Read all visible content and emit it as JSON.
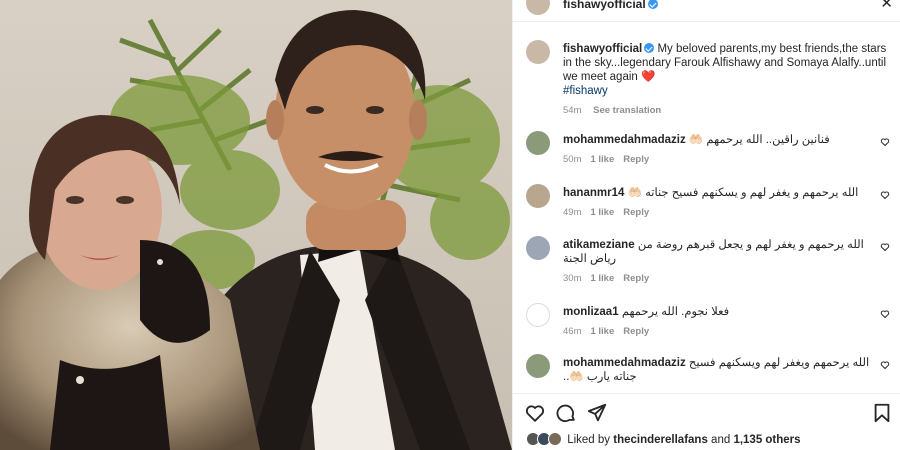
{
  "post": {
    "username": "fishawyofficial",
    "close_glyph": "✕",
    "image_alt": "Vintage photo of a couple, a woman in a fur coat and a man in a tuxedo with a bow tie"
  },
  "caption": {
    "username": "fishawyofficial",
    "text": "My beloved parents,my best friends,the stars in the sky...legendary Farouk Alfishawy and Somaya Alalfy..until we meet again",
    "emoji": "❤️",
    "hashtag": "#fishawy",
    "time": "54m",
    "see_translation": "See translation"
  },
  "comments": [
    {
      "username": "mohammedahmadaziz",
      "text": "فنانين راقين.. الله يرحمهم 🤲🏻",
      "time": "50m",
      "likes": "1 like",
      "reply": "Reply",
      "avatar_color": "#8a9a7a"
    },
    {
      "username": "hananmr14",
      "text": "الله يرحمهم و يغفر لهم و يسكنهم فسيح جناته 🤲🏻",
      "time": "49m",
      "likes": "1 like",
      "reply": "Reply",
      "avatar_color": "#b9a68f"
    },
    {
      "username": "atikameziane",
      "text": "الله يرحمهم و يغفر لهم و يجعل قبرهم روضة من رياض الجنة",
      "time": "30m",
      "likes": "1 like",
      "reply": "Reply",
      "avatar_color": "#9ca6b5"
    },
    {
      "username": "monlizaa1",
      "text": "فعلا نجوم. الله يرحمهم",
      "time": "46m",
      "likes": "1 like",
      "reply": "Reply",
      "avatar_color": "#ffffff"
    },
    {
      "username": "mohammedahmadaziz",
      "text": "الله يرحمهم ويغفر لهم ويسكنهم فسيح جناته يارب 🤲🏻..",
      "time": "",
      "likes": "",
      "reply": "",
      "avatar_color": "#8a9a7a"
    }
  ],
  "likes": {
    "prefix": "Liked by",
    "user": "thecinderellafans",
    "and": "and",
    "count": "1,135 others"
  },
  "icons": [
    "heart-icon",
    "comment-icon",
    "share-icon",
    "bookmark-icon"
  ],
  "colors": {
    "accent": "#3897f0",
    "heart": "#ed4956",
    "link": "#00376b",
    "muted": "#8e8e8e"
  }
}
